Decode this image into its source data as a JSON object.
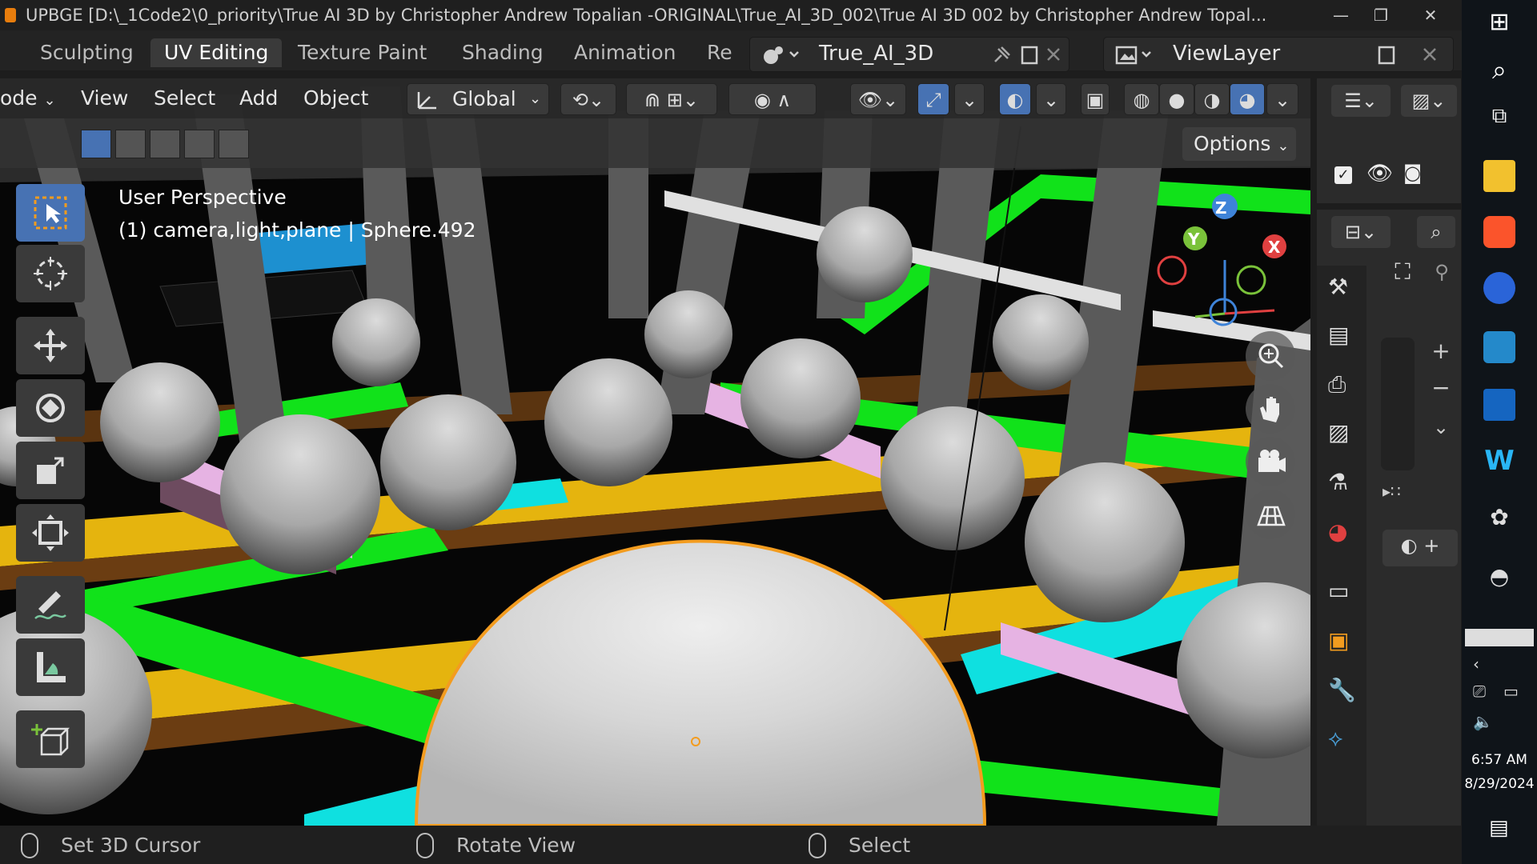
{
  "window": {
    "title": "UPBGE [D:\\_1Code2\\0_priority\\True AI 3D by Christopher Andrew Topalian -ORIGINAL\\True_AI_3D_002\\True AI 3D 002 by Christopher Andrew Topal..."
  },
  "workspace_tabs": [
    {
      "label": "Sculpting"
    },
    {
      "label": "UV Editing"
    },
    {
      "label": "Texture Paint"
    },
    {
      "label": "Shading"
    },
    {
      "label": "Animation"
    },
    {
      "label": "Re"
    }
  ],
  "scene_selector": {
    "value": "True_AI_3D"
  },
  "view_layer": {
    "value": "ViewLayer"
  },
  "viewport_header": {
    "mode": "ode",
    "menus": [
      "View",
      "Select",
      "Add",
      "Object"
    ],
    "transform_orientation": "Global",
    "options_label": "Options"
  },
  "viewport_overlay": {
    "perspective": "User Perspective",
    "object_info": "(1) camera,light,plane | Sphere.492"
  },
  "gizmo": {
    "x": "X",
    "y": "Y",
    "z": "Z"
  },
  "statusbar": {
    "left": "Set 3D Cursor",
    "middle": "Rotate View",
    "right": "Select"
  },
  "taskbar": {
    "time": "6:57 AM",
    "date": "8/29/2024"
  },
  "colors": {
    "accent": "#4772b3",
    "selection": "#f39c1f",
    "green_bar": "#11e21a",
    "yellow_bar": "#e5b40e",
    "cyan_bar": "#0fe0e0",
    "pink_bar": "#e6b3e3"
  }
}
